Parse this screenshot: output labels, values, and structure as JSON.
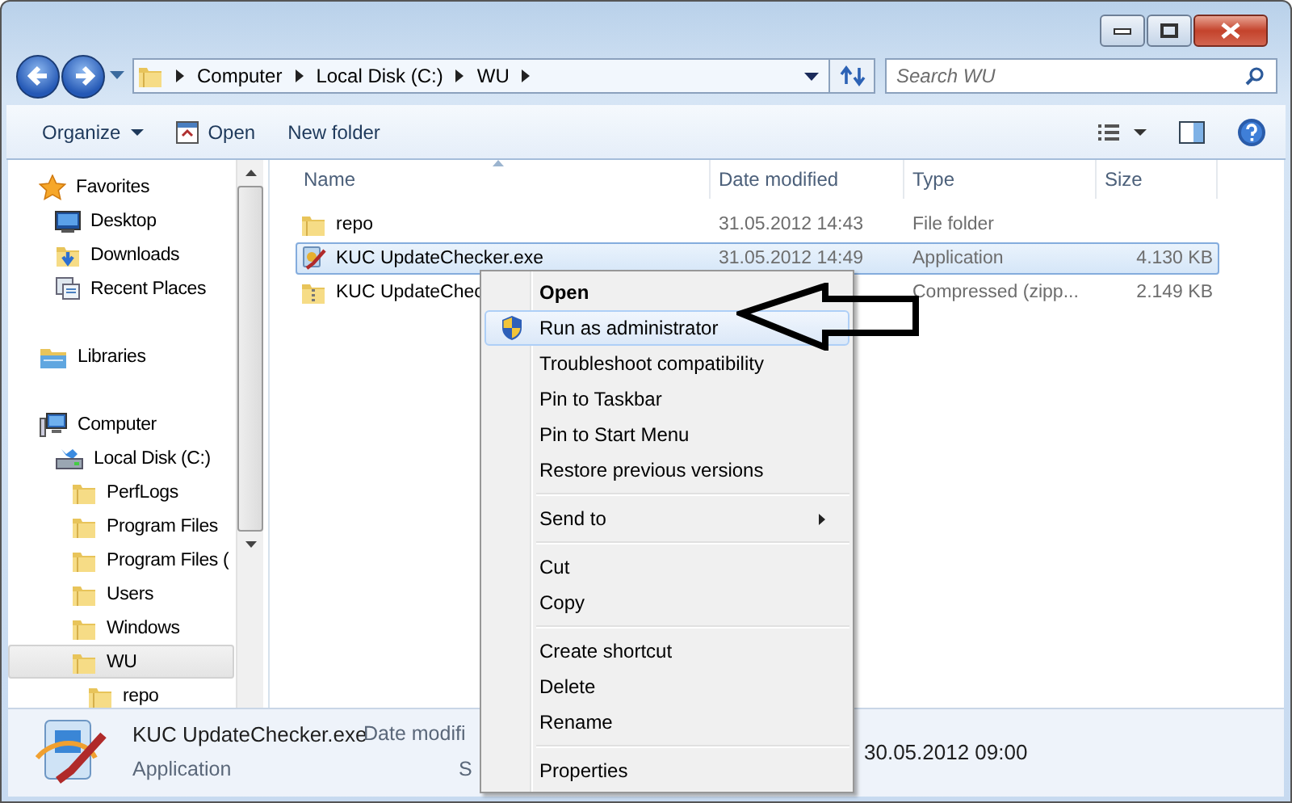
{
  "address": {
    "crumbs": [
      "Computer",
      "Local Disk (C:)",
      "WU"
    ]
  },
  "search": {
    "placeholder": "Search WU"
  },
  "toolbar": {
    "buttons": [
      {
        "label": "Organize",
        "kind": "dropdown"
      },
      {
        "label": "Open",
        "kind": "open"
      },
      {
        "label": "New folder",
        "kind": "plain"
      }
    ]
  },
  "sidebar": {
    "items": [
      {
        "label": "Favorites",
        "kind": "favorites",
        "selected": false,
        "children": [
          {
            "label": "Desktop",
            "kind": "desktop",
            "selected": false
          },
          {
            "label": "Downloads",
            "kind": "downloads",
            "selected": false
          },
          {
            "label": "Recent Places",
            "kind": "recent",
            "selected": false
          }
        ]
      },
      {
        "label": "Libraries",
        "kind": "libraries",
        "selected": false
      },
      {
        "label": "Computer",
        "kind": "computer",
        "selected": false,
        "children": [
          {
            "label": "Local Disk (C:)",
            "kind": "disk",
            "selected": false,
            "children": [
              {
                "label": "PerfLogs",
                "kind": "folder",
                "selected": false
              },
              {
                "label": "Program Files",
                "kind": "folder",
                "selected": false
              },
              {
                "label": "Program Files (",
                "kind": "folder",
                "selected": false
              },
              {
                "label": "Users",
                "kind": "folder",
                "selected": false
              },
              {
                "label": "Windows",
                "kind": "folder",
                "selected": false
              },
              {
                "label": "WU",
                "kind": "folder",
                "selected": true,
                "children": [
                  {
                    "label": "repo",
                    "kind": "folder",
                    "selected": false
                  }
                ]
              }
            ]
          }
        ]
      }
    ]
  },
  "table": {
    "columns": [
      "Name",
      "Date modified",
      "Type",
      "Size"
    ],
    "rows": [
      {
        "kind": "folder",
        "name": "repo",
        "date": "31.05.2012 14:43",
        "type": "File folder",
        "selected": false
      },
      {
        "kind": "app",
        "name": "KUC UpdateChecker.exe",
        "date": "31.05.2012 14:49",
        "type": "Application",
        "size": "4.130 KB",
        "selected": true
      },
      {
        "kind": "zip",
        "name": "KUC UpdateChec",
        "type": "Compressed (zipp...",
        "size": "2.149 KB",
        "selected": false
      }
    ]
  },
  "context_menu": {
    "groups": [
      [
        {
          "label": "Open",
          "default": true,
          "highlighted": false,
          "submenu": false
        },
        {
          "label": "Run as administrator",
          "default": false,
          "highlighted": true,
          "submenu": false,
          "kind": "shield"
        },
        {
          "label": "Troubleshoot compatibility",
          "default": false,
          "highlighted": false,
          "submenu": false
        },
        {
          "label": "Pin to Taskbar",
          "default": false,
          "highlighted": false,
          "submenu": false
        },
        {
          "label": "Pin to Start Menu",
          "default": false,
          "highlighted": false,
          "submenu": false
        },
        {
          "label": "Restore previous versions",
          "default": false,
          "highlighted": false,
          "submenu": false
        }
      ],
      [
        {
          "label": "Send to",
          "default": false,
          "highlighted": false,
          "submenu": true
        }
      ],
      [
        {
          "label": "Cut",
          "default": false,
          "highlighted": false,
          "submenu": false
        },
        {
          "label": "Copy",
          "default": false,
          "highlighted": false,
          "submenu": false
        }
      ],
      [
        {
          "label": "Create shortcut",
          "default": false,
          "highlighted": false,
          "submenu": false
        },
        {
          "label": "Delete",
          "default": false,
          "highlighted": false,
          "submenu": false
        },
        {
          "label": "Rename",
          "default": false,
          "highlighted": false,
          "submenu": false
        }
      ],
      [
        {
          "label": "Properties",
          "default": false,
          "highlighted": false,
          "submenu": false
        }
      ]
    ]
  },
  "details": {
    "name": "KUC UpdateChecker.exe",
    "type": "Application",
    "label_1": "Date modifi",
    "label_2": "S",
    "value_1": "30.05.2012 09:00"
  }
}
